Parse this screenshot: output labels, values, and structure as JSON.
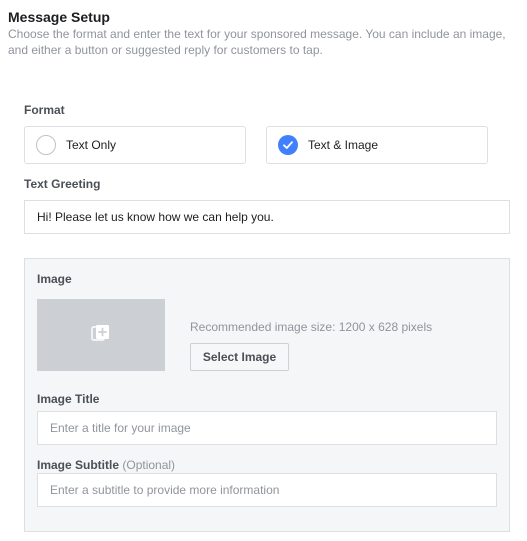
{
  "header": {
    "title": "Message Setup",
    "description": "Choose the format and enter the text for your sponsored message. You can include an image, and either a button or suggested reply for customers to tap."
  },
  "format": {
    "label": "Format",
    "options": [
      {
        "label": "Text Only",
        "selected": false
      },
      {
        "label": "Text & Image",
        "selected": true
      }
    ]
  },
  "greeting": {
    "label": "Text Greeting",
    "value": "Hi! Please let us know how we can help you."
  },
  "image": {
    "label": "Image",
    "placeholder_icon": "add-image-icon",
    "recommended_text": "Recommended image size: 1200 x 628 pixels",
    "select_button": "Select Image",
    "title_label": "Image Title",
    "title_placeholder": "Enter a title for your image",
    "subtitle_label": "Image Subtitle",
    "subtitle_optional": "(Optional)",
    "subtitle_placeholder": "Enter a subtitle to provide more information"
  },
  "colors": {
    "accent": "#4080ff",
    "border": "#dddfe2",
    "panel_bg": "#f5f6f7",
    "placeholder_bg": "#ccd0d5"
  }
}
